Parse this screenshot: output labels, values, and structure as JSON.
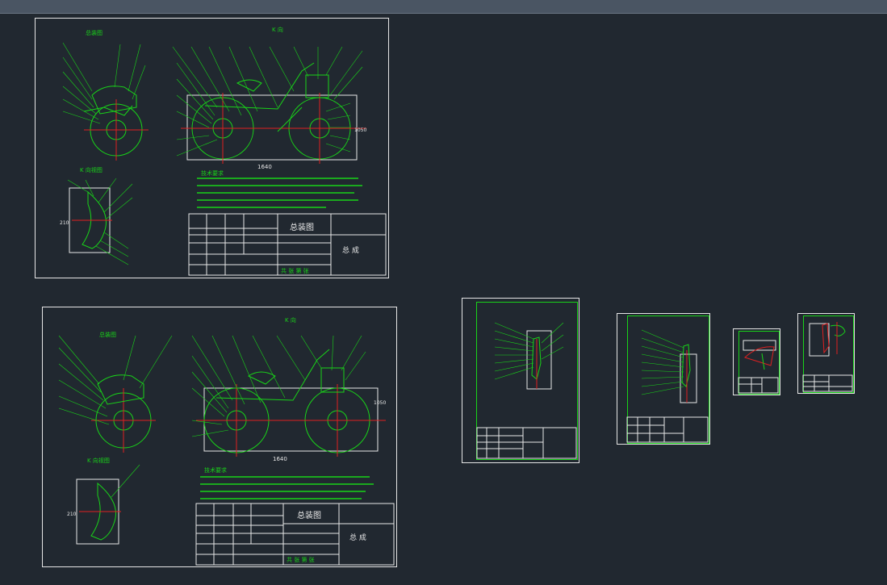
{
  "app": {
    "viewport_bg": "#212830",
    "line_color": "#19d419",
    "border_color": "#e6e6e6",
    "accent_red": "#e02020"
  },
  "drawing1": {
    "view_title": "总装图",
    "dimension_length": "1640",
    "dimension_height": "1050",
    "dimension_side": "210",
    "k_label": "K 向",
    "k_view_label": "K 向视图",
    "notes_title": "技术要求",
    "title_block_name": "总装图",
    "title_block_part": "总    成",
    "title_block_bottom": "共   张  第   张"
  },
  "drawing2": {
    "view_title": "总装图",
    "dimension_length": "1640",
    "dimension_height": "1050",
    "dimension_side": "210",
    "k_label": "K 向",
    "k_view_label": "K 向视图",
    "notes_title": "技术要求",
    "title_block_name": "总装图",
    "title_block_part": "总    成",
    "title_block_bottom": "共   张  第   张"
  }
}
